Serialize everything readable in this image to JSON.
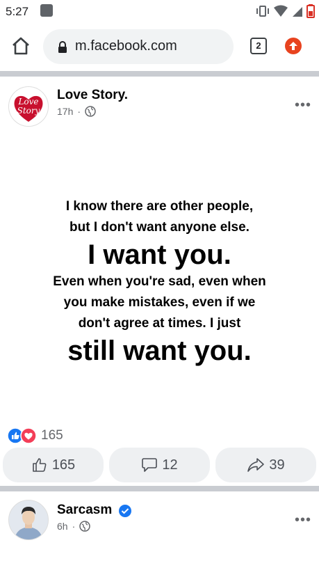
{
  "status_bar": {
    "time": "5:27"
  },
  "browser": {
    "url": "m.facebook.com",
    "tab_count": "2"
  },
  "posts": [
    {
      "author": "Love Story.",
      "time": "17h",
      "separator": "·",
      "avatar_text": [
        "Love",
        "Story"
      ],
      "quote": [
        "I know there are other people,",
        "but I don't want anyone else.",
        "I want you.",
        "Even when you're sad, even when",
        "you make mistakes, even if we",
        "don't agree at times. I just",
        "still want you."
      ],
      "reaction_count": "165",
      "actions": {
        "like": "165",
        "comment": "12",
        "share": "39"
      }
    },
    {
      "author": "Sarcasm",
      "time": "6h",
      "separator": "·",
      "verified": true
    }
  ],
  "colors": {
    "like_blue": "#1877f2",
    "love_red": "#f33e58",
    "update_red": "#e8431f"
  }
}
